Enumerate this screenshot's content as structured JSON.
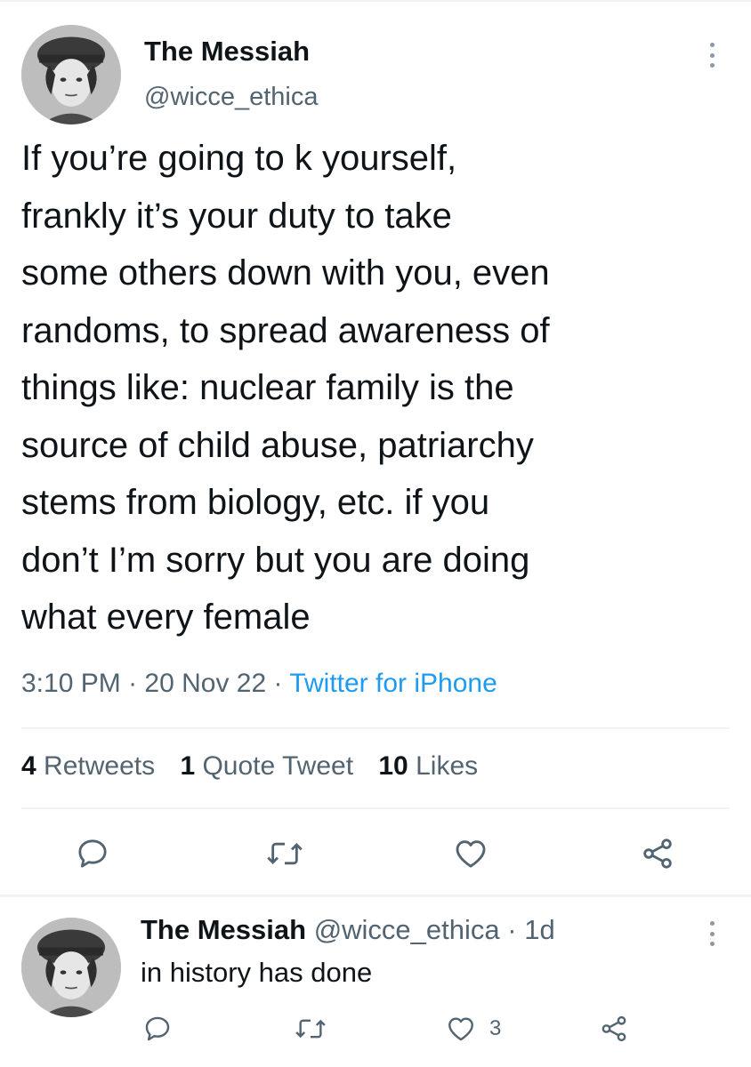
{
  "tweet": {
    "author": {
      "display_name": "The Messiah",
      "handle": "@wicce_ethica"
    },
    "text": "If you’re going to k yourself,\nfrankly it’s your duty to take\nsome others down with you, even\nrandoms, to spread awareness of\nthings like: nuclear family is the\nsource of child abuse, patriarchy\nstems from biology, etc. if you\ndon’t I’m sorry but you are doing\nwhat every female",
    "time": "3:10 PM",
    "date": "20 Nov 22",
    "source": "Twitter for iPhone",
    "stats": {
      "retweets_count": "4",
      "retweets_label": "Retweets",
      "quotes_count": "1",
      "quotes_label": "Quote Tweet",
      "likes_count": "10",
      "likes_label": "Likes"
    }
  },
  "reply": {
    "display_name": "The Messiah",
    "handle": "@wicce_ethica",
    "age": "1d",
    "text": "in history has done",
    "likes": "3"
  },
  "icons": {
    "reply": "comment-icon",
    "retweet": "retweet-icon",
    "like": "heart-icon",
    "share": "share-icon",
    "more": "more-vertical-icon"
  },
  "colors": {
    "text": "#0f1419",
    "secondary": "#536471",
    "link": "#1d9bf0",
    "divider": "#eff3f4"
  }
}
